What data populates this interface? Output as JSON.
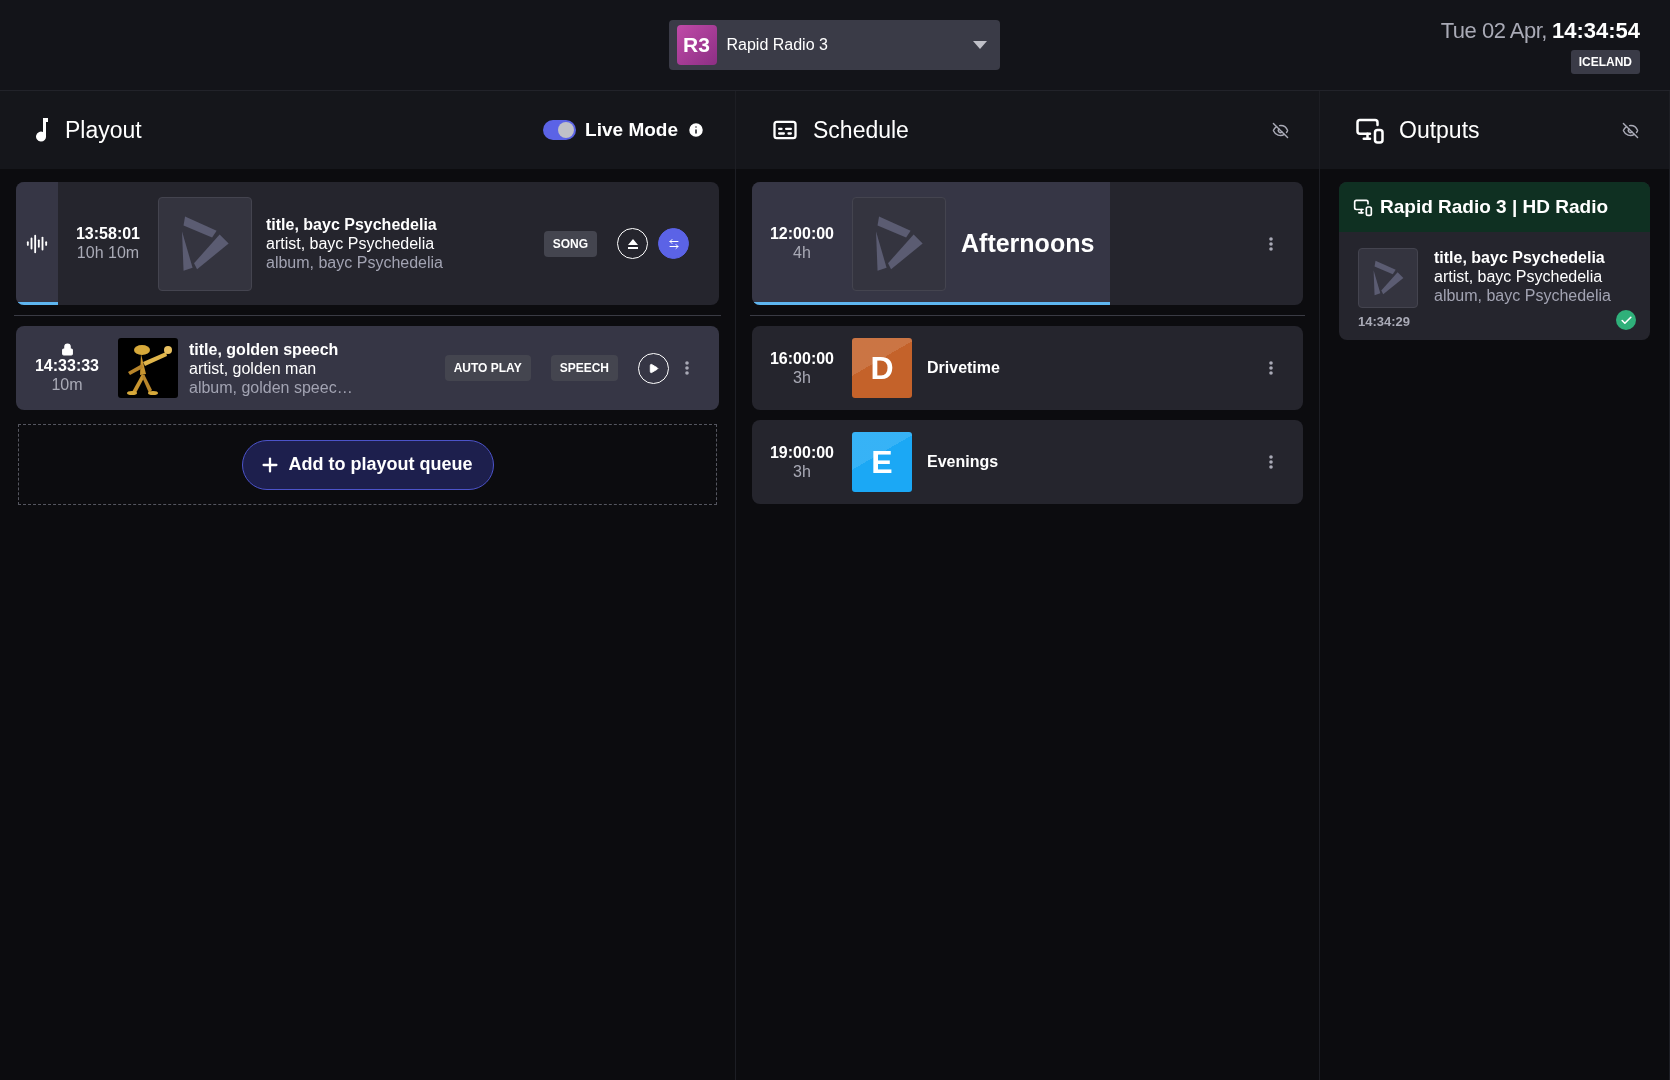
{
  "station_selector": {
    "badge": "R3",
    "name": "Rapid Radio 3"
  },
  "clock": {
    "date": "Tue 02 Apr,",
    "time": "14:34:54",
    "timezone": "ICELAND"
  },
  "playout": {
    "title": "Playout",
    "live_mode": {
      "label": "Live Mode",
      "on": true
    },
    "items": [
      {
        "kind": "playing",
        "start": "13:58:01",
        "duration": "10h 10m",
        "art": {
          "kind": "logo"
        },
        "title": "title, bayc Psychedelia",
        "artist": "artist, bayc Psychedelia",
        "album": "album, bayc Psychedelia",
        "tags": [
          "SONG"
        ],
        "level": 0.06
      },
      {
        "kind": "queued",
        "locked": true,
        "start": "14:33:33",
        "duration": "10m",
        "art": {
          "kind": "picture"
        },
        "title": "title, golden speech",
        "artist": "artist, golden man",
        "album": "album, golden speec…",
        "tags": [
          "AUTO PLAY",
          "SPEECH"
        ]
      }
    ],
    "add_button": "Add to playout queue"
  },
  "schedule": {
    "title": "Schedule",
    "items": [
      {
        "start": "12:00:00",
        "duration": "4h",
        "name": "Afternoons",
        "art": {
          "kind": "logo"
        },
        "current": true,
        "level": 0.65
      },
      {
        "start": "16:00:00",
        "duration": "3h",
        "name": "Drivetime",
        "art": {
          "kind": "letter",
          "letter": "D",
          "color": "#c4622a"
        },
        "current": false
      },
      {
        "start": "19:00:00",
        "duration": "3h",
        "name": "Evenings",
        "art": {
          "kind": "letter",
          "letter": "E",
          "color": "#1ba8f5"
        },
        "current": false
      }
    ]
  },
  "outputs": {
    "title": "Outputs",
    "items": [
      {
        "name": "Rapid Radio 3 | HD Radio",
        "title": "title, bayc Psychedelia",
        "artist": "artist, bayc Psychedelia",
        "album": "album, bayc Psychedelia",
        "time": "14:34:29",
        "ok": true
      }
    ]
  }
}
